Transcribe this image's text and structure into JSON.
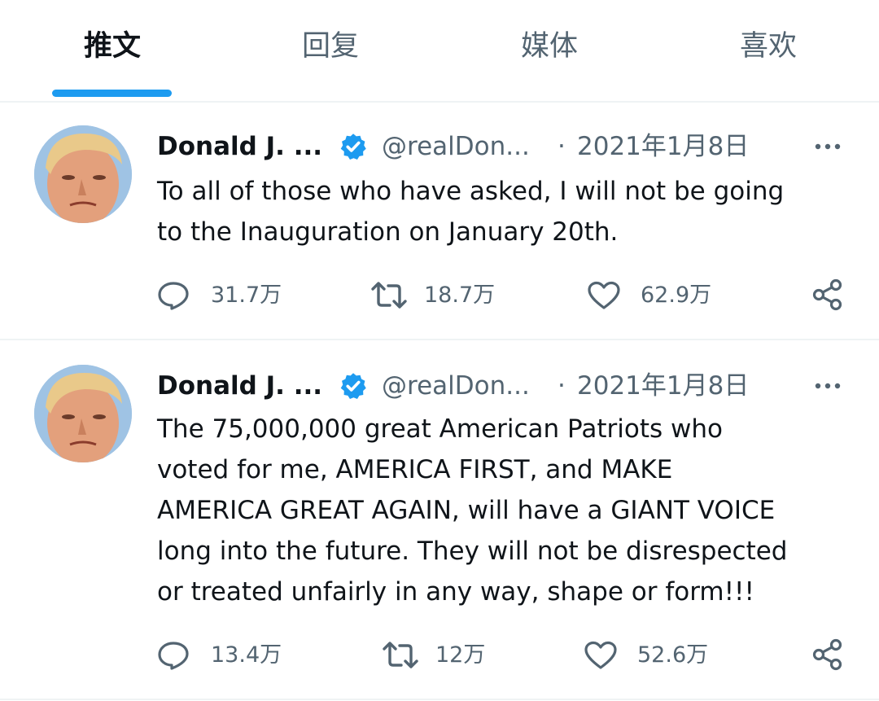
{
  "tabs": [
    {
      "label": "推文",
      "active": true
    },
    {
      "label": "回复",
      "active": false
    },
    {
      "label": "媒体",
      "active": false
    },
    {
      "label": "喜欢",
      "active": false
    }
  ],
  "accent_color": "#1d9bf0",
  "tweets": [
    {
      "name": "Donald J. ...",
      "handle": "@realDon...",
      "separator": "·",
      "date": "2021年1月8日",
      "lines": [
        "To all of those who have asked, I will not be going",
        "to the Inauguration on January 20th."
      ],
      "replies": "31.7万",
      "retweets": "18.7万",
      "likes": "62.9万"
    },
    {
      "name": "Donald J. ...",
      "handle": "@realDon...",
      "separator": "·",
      "date": "2021年1月8日",
      "lines": [
        "The 75,000,000 great American Patriots who",
        "voted for me, AMERICA FIRST, and MAKE",
        "AMERICA GREAT AGAIN, will have a GIANT VOICE",
        "long into the future. They will not be disrespected",
        "or treated unfairly in any way, shape or form!!!"
      ],
      "replies": "13.4万",
      "retweets": "12万",
      "likes": "52.6万"
    }
  ],
  "icons": {
    "verified": "verified-badge-icon",
    "more": "more-options-icon",
    "reply": "reply-icon",
    "retweet": "retweet-icon",
    "like": "like-icon",
    "share": "share-icon"
  }
}
